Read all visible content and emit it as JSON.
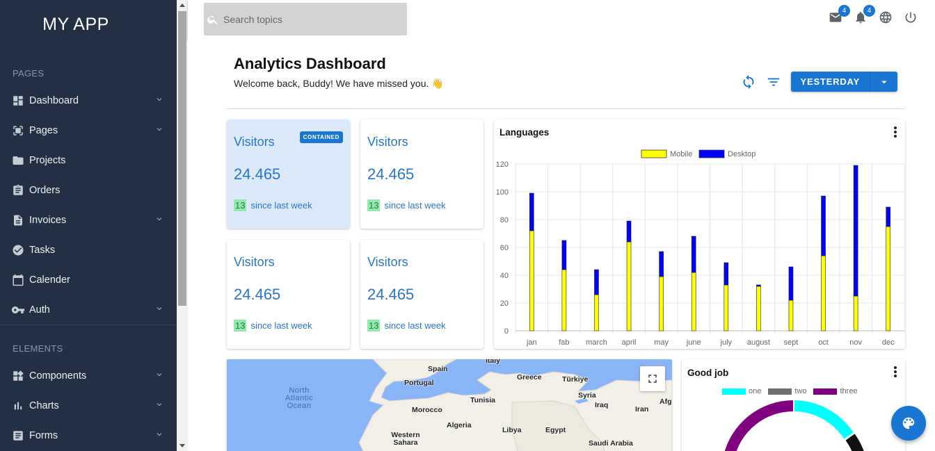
{
  "brand": "MY APP",
  "sidebar": {
    "sections": [
      {
        "title": "PAGES",
        "items": [
          {
            "label": "Dashboard",
            "icon": "dashboard-icon",
            "chevron": true
          },
          {
            "label": "Pages",
            "icon": "pages-icon",
            "chevron": true
          },
          {
            "label": "Projects",
            "icon": "folder-icon",
            "chevron": false
          },
          {
            "label": "Orders",
            "icon": "clipboard-icon",
            "chevron": false
          },
          {
            "label": "Invoices",
            "icon": "document-icon",
            "chevron": true
          },
          {
            "label": "Tasks",
            "icon": "check-circle-icon",
            "chevron": false
          },
          {
            "label": "Calender",
            "icon": "calendar-icon",
            "chevron": false
          },
          {
            "label": "Auth",
            "icon": "key-icon",
            "chevron": true
          }
        ]
      },
      {
        "title": "ELEMENTS",
        "items": [
          {
            "label": "Components",
            "icon": "widgets-icon",
            "chevron": true
          },
          {
            "label": "Charts",
            "icon": "bar-chart-icon",
            "chevron": true
          },
          {
            "label": "Forms",
            "icon": "form-icon",
            "chevron": true
          }
        ]
      }
    ]
  },
  "topbar": {
    "search_placeholder": "Search topics",
    "mail_badge": "4",
    "notif_badge": "4"
  },
  "header": {
    "title": "Analytics Dashboard",
    "welcome": "Welcome back, Buddy! We have missed you. 👋",
    "range_button": "YESTERDAY"
  },
  "stats": [
    {
      "title": "Visitors",
      "value": "24.465",
      "change": "13",
      "since": "since last week",
      "chip": "CONTAINED"
    },
    {
      "title": "Visitors",
      "value": "24.465",
      "change": "13",
      "since": "since last week"
    },
    {
      "title": "Visitors",
      "value": "24.465",
      "change": "13",
      "since": "since last week"
    },
    {
      "title": "Visitors",
      "value": "24.465",
      "change": "13",
      "since": "since last week"
    }
  ],
  "languages_card": {
    "title": "Languages"
  },
  "chart_data": {
    "type": "bar",
    "stacked": true,
    "categories": [
      "jan",
      "fab",
      "march",
      "april",
      "may",
      "june",
      "july",
      "august",
      "sept",
      "oct",
      "nov",
      "dec"
    ],
    "series": [
      {
        "name": "Mobile",
        "color": "#ffff00",
        "values": [
          72,
          44,
          26,
          64,
          39,
          42,
          33,
          32,
          22,
          54,
          25,
          75
        ]
      },
      {
        "name": "Desktop",
        "color": "#0000ff",
        "values": [
          27,
          21,
          18,
          15,
          18,
          26,
          16,
          1,
          24,
          43,
          94,
          14
        ]
      }
    ],
    "ylim": [
      0,
      120
    ],
    "yticks": [
      "0",
      "20",
      "40",
      "60",
      "80",
      "100",
      "120"
    ],
    "legend": "top",
    "grid": true
  },
  "map": {
    "labels": [
      "Italy",
      "Spain",
      "Portugal",
      "Greece",
      "Türkiye",
      "Tunisia",
      "Syria",
      "Morocco",
      "Iraq",
      "Afg",
      "Algeria",
      "Iran",
      "Libya",
      "Egypt",
      "Western Sahara",
      "Saudi Arabia"
    ],
    "ocean": [
      "North",
      "Atlantic",
      "Ocean"
    ],
    "water_color": "#8ab4f8",
    "land_color": "#f1efe8"
  },
  "donut_card": {
    "title": "Good job",
    "legend": [
      {
        "name": "one",
        "color": "#00ffff"
      },
      {
        "name": "two",
        "color": "#707070"
      },
      {
        "name": "three",
        "color": "#800080"
      }
    ]
  },
  "colors": {
    "sidebar": "#233044",
    "primary": "#1976d2",
    "accent_text": "#2a75cc"
  }
}
